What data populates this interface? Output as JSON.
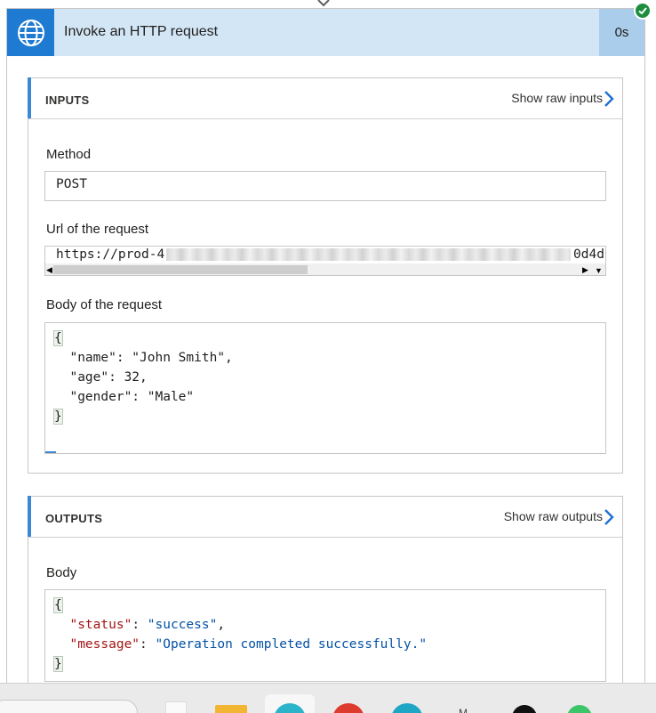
{
  "action": {
    "title": "Invoke an HTTP request",
    "duration": "0s",
    "status": "success"
  },
  "inputs": {
    "title": "INPUTS",
    "raw_link": "Show raw inputs",
    "method_label": "Method",
    "method_value": "POST",
    "url_label": "Url of the request",
    "url_value_start": "https://prod-4",
    "url_value_end": "0d4d",
    "body_label": "Body of the request",
    "body_lines": [
      "{",
      "  \"name\": \"John Smith\",",
      "  \"age\": 32,",
      "  \"gender\": \"Male\"",
      "}"
    ]
  },
  "outputs": {
    "title": "OUTPUTS",
    "raw_link": "Show raw outputs",
    "body_label": "Body",
    "status_key": "\"status\"",
    "status_value": "\"success\"",
    "message_key": "\"message\"",
    "message_value": "\"Operation completed successfully.\""
  },
  "colors": {
    "header_bg": "#d3e6f5",
    "icon_bg": "#1f7bd1",
    "accent": "#3d87d5",
    "success": "#1e8e3e",
    "json_key": "#a31515",
    "json_string": "#0451a5"
  },
  "icons": [
    "globe-icon",
    "success-check-icon",
    "chevron-right-icon"
  ]
}
